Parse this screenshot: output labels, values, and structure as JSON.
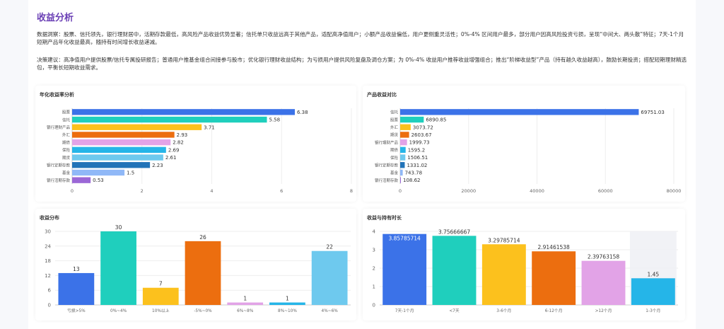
{
  "page": {
    "title": "收益分析",
    "insight": "数据洞察：股票、信托领先，银行理财居中，活期存款最低，高风险产品收益优势显著；信托单只收益远高于其他产品，适配高净值用户；小额产品收益偏低，用户更侧重灵活性；0%-4% 区间用户最多，部分用户因高风险投资亏损，呈现“中间大、两头散”特征；7天-1个月短期产品年化收益最高，随持有时间增长收益递减。",
    "advice": "决策建议：高净值用户提供股票/信托专属投研报告；普通用户推基金组合间接参与股市；优化银行理财收益结构；为亏损用户提供风险复盘及调仓方案；为 0%-4% 收益用户推荐收益增强组合；推出“阶梯收益型”产品（持有越久收益越高），鼓励长期投资；搭配短期理财精选包，平衡长短期收益需求。"
  },
  "chart_data": [
    {
      "type": "bar",
      "orientation": "horizontal",
      "title": "年化收益率分析",
      "categories": [
        "股票",
        "信托",
        "银行理财产品",
        "外汇",
        "期债",
        "保险",
        "期货",
        "银行定期存款",
        "基金",
        "银行活期存款"
      ],
      "values": [
        6.38,
        5.58,
        3.71,
        2.93,
        2.82,
        2.69,
        2.61,
        2.23,
        1.5,
        0.53
      ],
      "value_labels": [
        "6.38",
        "5.58",
        "3.71",
        "2.93",
        "2.82",
        "2.69",
        "2.61",
        "2.23",
        "1.5",
        "0.53"
      ],
      "colors": [
        "#3b72e8",
        "#1fcfbd",
        "#fcc11d",
        "#ec6e0f",
        "#e2a3e7",
        "#25b5e8",
        "#6ec9ee",
        "#2173b8",
        "#90b8f7",
        "#9b67d6"
      ],
      "xlim": [
        0,
        8
      ],
      "xticks": [
        "0",
        "2",
        "4",
        "6",
        "8"
      ]
    },
    {
      "type": "bar",
      "orientation": "horizontal",
      "title": "产品收益对比",
      "categories": [
        "信托",
        "股票",
        "外汇",
        "期货",
        "银行理财产品",
        "期债",
        "保险",
        "银行定期存款",
        "基金",
        "银行活期存款"
      ],
      "values": [
        69751.03,
        6890.85,
        3073.72,
        2603.67,
        1999.73,
        1595.2,
        1506.51,
        1331.02,
        743.78,
        108.62
      ],
      "value_labels": [
        "69751.03",
        "6890.85",
        "3073.72",
        "2603.67",
        "1999.73",
        "1595.2",
        "1506.51",
        "1331.02",
        "743.78",
        "108.62"
      ],
      "colors": [
        "#3b72e8",
        "#1fcfbd",
        "#fcc11d",
        "#ec6e0f",
        "#e2a3e7",
        "#25b5e8",
        "#6ec9ee",
        "#2173b8",
        "#90b8f7",
        "#9b67d6"
      ],
      "xlim": [
        0,
        80000
      ],
      "xticks": [
        "0",
        "20000",
        "40000",
        "60000",
        "80000"
      ]
    },
    {
      "type": "bar",
      "title": "收益分布",
      "categories": [
        "亏损>5%",
        "0%~4%",
        "10%以上",
        "-5%~0%",
        "6%~8%",
        "8%~10%",
        "4%~6%"
      ],
      "values": [
        13,
        30,
        7,
        26,
        1,
        1,
        22
      ],
      "value_labels": [
        "13",
        "30",
        "7",
        "26",
        "1",
        "1",
        "22"
      ],
      "colors": [
        "#3b72e8",
        "#1fcfbd",
        "#fcc11d",
        "#ec6e0f",
        "#e2a3e7",
        "#25b5e8",
        "#6ec9ee"
      ],
      "ylim": [
        0,
        30
      ],
      "yticks": [
        "0",
        "6",
        "12",
        "18",
        "24",
        "30"
      ]
    },
    {
      "type": "bar",
      "title": "收益与持有时长",
      "categories": [
        "7天-1个月",
        "<7天",
        "3-6个月",
        "6-12个月",
        ">12个月",
        "1-3个月"
      ],
      "values": [
        3.85785714,
        3.75666667,
        3.29785714,
        2.91461538,
        2.39763158,
        1.45
      ],
      "value_labels": [
        "3.85785714",
        "3.75666667",
        "3.29785714",
        "2.91461538",
        "2.39763158",
        "1.45"
      ],
      "colors": [
        "#3b72e8",
        "#1fcfbd",
        "#fcc11d",
        "#ec6e0f",
        "#e2a3e7",
        "#25b5e8"
      ],
      "ylim": [
        0,
        4
      ],
      "yticks": [
        "0",
        "1",
        "2",
        "3",
        "4"
      ]
    }
  ]
}
